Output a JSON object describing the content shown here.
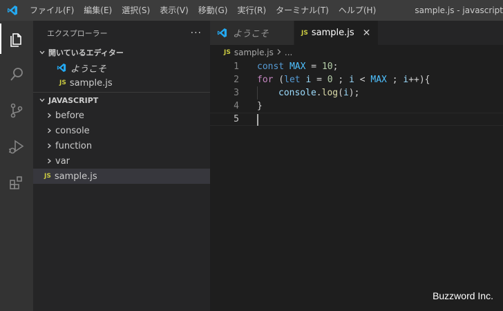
{
  "titlebar": {
    "menu": [
      "ファイル(F)",
      "編集(E)",
      "選択(S)",
      "表示(V)",
      "移動(G)",
      "実行(R)",
      "ターミナル(T)",
      "ヘルプ(H)"
    ],
    "window_title": "sample.js - javascript"
  },
  "activitybar": {
    "icons": [
      "explorer-icon",
      "search-icon",
      "source-control-icon",
      "run-debug-icon",
      "extensions-icon"
    ]
  },
  "sidebar": {
    "title": "エクスプローラー",
    "more": "···",
    "open_editors": {
      "label": "開いているエディター",
      "items": [
        {
          "name": "ようこそ",
          "icon": "vscode-icon"
        },
        {
          "name": "sample.js",
          "icon": "JS"
        }
      ]
    },
    "folder": {
      "label": "JAVASCRIPT",
      "children": [
        "before",
        "console",
        "function",
        "var"
      ],
      "file": {
        "name": "sample.js",
        "icon": "JS"
      }
    }
  },
  "tabs": [
    {
      "label": "ようこそ",
      "active": false
    },
    {
      "label": "sample.js",
      "icon": "JS",
      "active": true,
      "close": "✕"
    }
  ],
  "breadcrumb": {
    "file": "sample.js",
    "icon": "JS",
    "rest": "..."
  },
  "editor": {
    "line_numbers": [
      "1",
      "2",
      "3",
      "4",
      "5"
    ],
    "lines": {
      "l1": {
        "kw": "const",
        "name": "MAX",
        "op": " = ",
        "num": "10",
        "end": ";"
      },
      "l2": {
        "kw": "for",
        "p1": " (",
        "kw2": "let",
        "v1": " i",
        "op1": " = ",
        "n1": "0",
        "s1": " ; ",
        "v2": "i",
        "op2": " < ",
        "c": "MAX",
        "s2": " ; ",
        "v3": "i",
        "end": "++){"
      },
      "l3": {
        "obj": "console",
        "dot": ".",
        "fn": "log",
        "p": "(",
        "arg": "i",
        "end": ");"
      },
      "l4": {
        "brace": "}"
      }
    }
  },
  "watermark": "Buzzword Inc.",
  "colors": {
    "accent": "#007acc",
    "js": "#cbcb41",
    "keyword": "#569cd6",
    "control": "#c586c0",
    "number": "#b5cea8"
  }
}
